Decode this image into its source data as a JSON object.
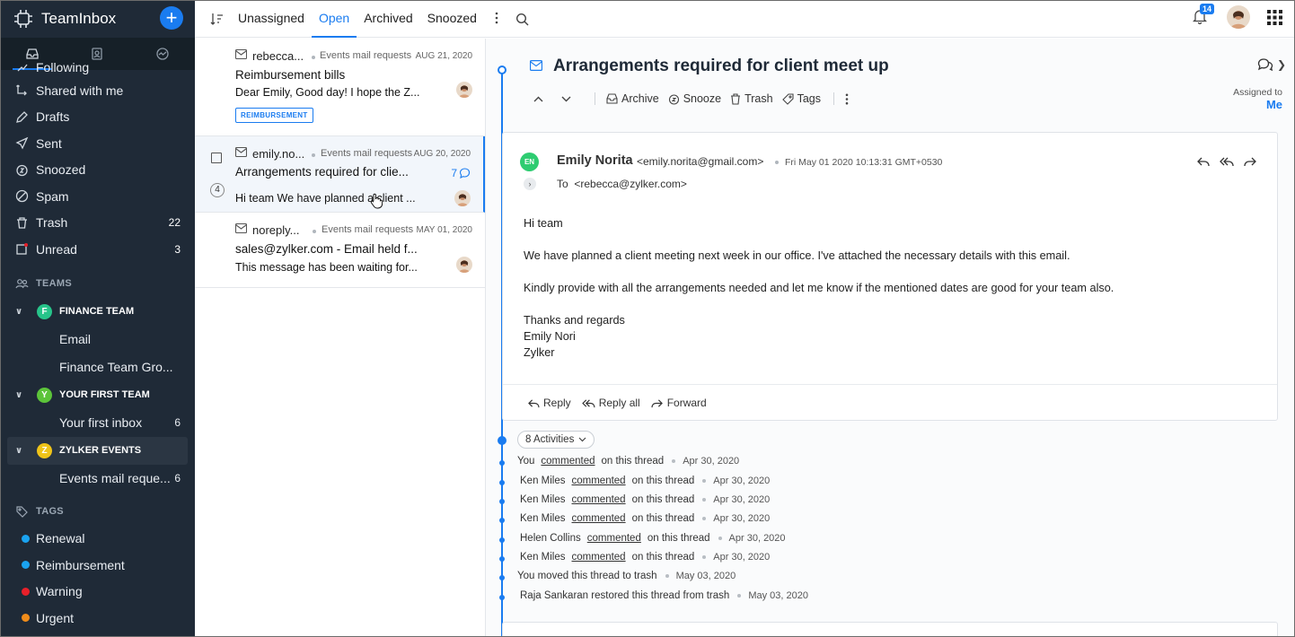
{
  "app": {
    "name": "TeamInbox",
    "add_icon": "plus-icon"
  },
  "sidebar": {
    "tabs": [
      "inbox-tab",
      "contacts-tab",
      "analytics-tab"
    ],
    "items": [
      {
        "label": "Following",
        "icon": "following-icon",
        "count": ""
      },
      {
        "label": "Shared with me",
        "icon": "shared-icon",
        "count": ""
      },
      {
        "label": "Drafts",
        "icon": "drafts-icon",
        "count": ""
      },
      {
        "label": "Sent",
        "icon": "sent-icon",
        "count": ""
      },
      {
        "label": "Snoozed",
        "icon": "snooze-icon",
        "count": ""
      },
      {
        "label": "Spam",
        "icon": "spam-icon",
        "count": ""
      },
      {
        "label": "Trash",
        "icon": "trash-icon",
        "count": "22"
      },
      {
        "label": "Unread",
        "icon": "unread-icon",
        "count": "3"
      }
    ],
    "teams_label": "TEAMS",
    "teams": [
      {
        "initial": "F",
        "name": "FINANCE TEAM",
        "color": "#27c48a",
        "subs": [
          {
            "label": "Email",
            "count": ""
          },
          {
            "label": "Finance Team Gro...",
            "count": ""
          }
        ]
      },
      {
        "initial": "Y",
        "name": "YOUR FIRST TEAM",
        "color": "#5cc43a",
        "subs": [
          {
            "label": "Your first inbox",
            "count": "6"
          }
        ]
      },
      {
        "initial": "Z",
        "name": "ZYLKER EVENTS",
        "color": "#f0c419",
        "subs": [
          {
            "label": "Events mail reque...",
            "count": "6"
          }
        ]
      }
    ],
    "tags_label": "TAGS",
    "tags": [
      {
        "label": "Renewal",
        "color": "#1aa3f0"
      },
      {
        "label": "Reimbursement",
        "color": "#1aa3f0"
      },
      {
        "label": "Warning",
        "color": "#e8202a"
      },
      {
        "label": "Urgent",
        "color": "#f08c1a"
      }
    ]
  },
  "topbar": {
    "tabs": [
      "Unassigned",
      "Open",
      "Archived",
      "Snoozed"
    ],
    "active_tab": "Open",
    "notifications": "14"
  },
  "messages": [
    {
      "from": "rebecca...",
      "inbox": "Events mail requests",
      "date": "AUG 21, 2020",
      "subject": "Reimbursement bills",
      "preview": "Dear Emily, Good day! I hope the Z...",
      "tag": "REIMBURSEMENT"
    },
    {
      "from": "emily.no...",
      "inbox": "Events mail requests",
      "date": "AUG 20, 2020",
      "subject": "Arrangements required for clie...",
      "preview": "Hi team We have planned a client ...",
      "thread_count": "4",
      "comments": "7"
    },
    {
      "from": "noreply...",
      "inbox": "Events mail requests",
      "date": "MAY 01, 2020",
      "subject": "sales@zylker.com - Email held f...",
      "preview": "This message has been waiting for..."
    }
  ],
  "detail": {
    "title": "Arrangements required for client meet up",
    "toolbar": {
      "archive": "Archive",
      "snooze": "Snooze",
      "trash": "Trash",
      "tags": "Tags"
    },
    "assigned_label": "Assigned to",
    "assigned_to": "Me",
    "mail": {
      "initials": "EN",
      "sender": "Emily Norita",
      "sender_email": "<emily.norita@gmail.com>",
      "date": "Fri May 01 2020 10:13:31 GMT+0530",
      "to_label": "To",
      "to": "<rebecca@zylker.com>",
      "body": [
        "Hi team",
        "We have planned a client meeting next week in our office. I've attached the necessary details with this email.",
        "Kindly provide with all the arrangements needed and let me know if the mentioned dates are good for your team also."
      ],
      "signature": [
        "Thanks and regards",
        "Emily Nori",
        "Zylker"
      ],
      "reply": "Reply",
      "reply_all": "Reply all",
      "forward": "Forward"
    },
    "activities_label": "8 Activities",
    "activities": [
      {
        "who": "You",
        "link": "commented",
        "rest": "on this thread",
        "date": "Apr 30, 2020"
      },
      {
        "who": "Ken Miles",
        "link": "commented",
        "rest": "on this thread",
        "date": "Apr 30, 2020"
      },
      {
        "who": "Ken Miles",
        "link": "commented",
        "rest": "on this thread",
        "date": "Apr 30, 2020"
      },
      {
        "who": "Ken Miles",
        "link": "commented",
        "rest": "on this thread",
        "date": "Apr 30, 2020"
      },
      {
        "who": "Helen Collins",
        "link": "commented",
        "rest": "on this thread",
        "date": "Apr 30, 2020"
      },
      {
        "who": "Ken Miles",
        "link": "commented",
        "rest": "on this thread",
        "date": "Apr 30, 2020"
      },
      {
        "who": "You moved this thread to trash",
        "link": "",
        "rest": "",
        "date": "May 03, 2020"
      },
      {
        "who": "Raja Sankaran restored this thread from trash",
        "link": "",
        "rest": "",
        "date": "May 03, 2020"
      }
    ]
  }
}
